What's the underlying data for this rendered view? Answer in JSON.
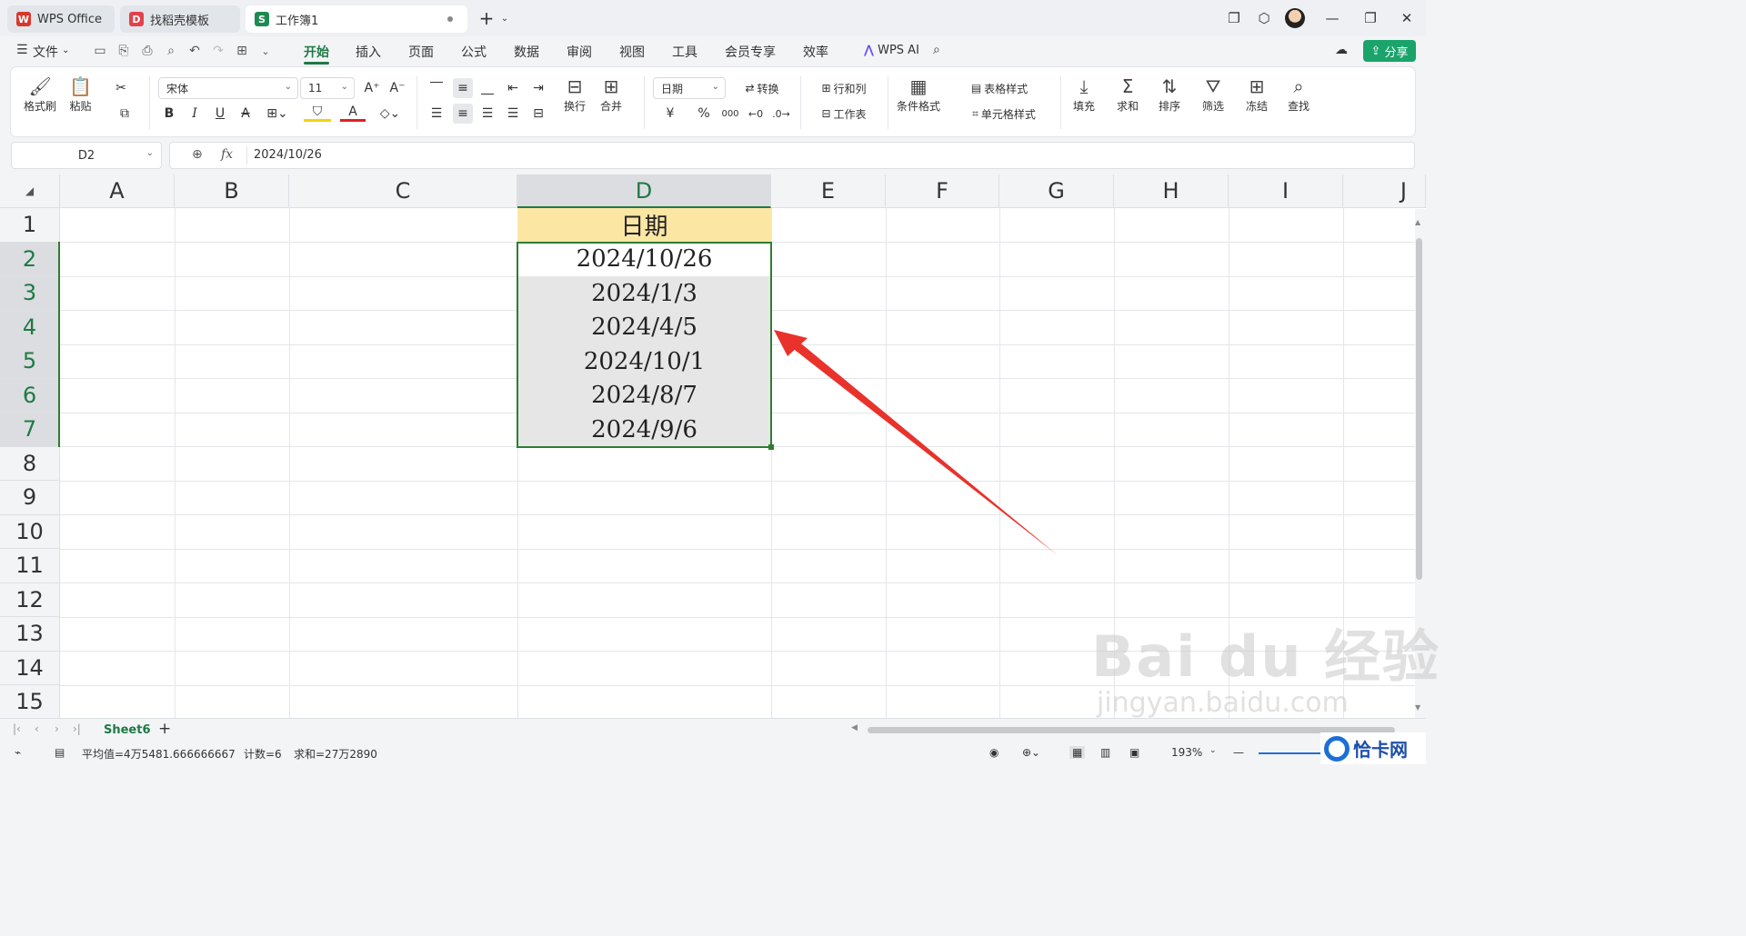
{
  "tabs": [
    {
      "label": "WPS Office",
      "badge": "W",
      "color": "#d8372c"
    },
    {
      "label": "找稻壳模板",
      "badge": "D",
      "color": "#e2424b"
    },
    {
      "label": "工作簿1",
      "badge": "S",
      "color": "#1e8a52"
    }
  ],
  "new_tab": "+",
  "menu": {
    "file": "文件",
    "items": [
      "开始",
      "插入",
      "页面",
      "公式",
      "数据",
      "审阅",
      "视图",
      "工具",
      "会员专享",
      "效率"
    ],
    "wps_ai": "WPS AI",
    "share": "分享"
  },
  "ribbon": {
    "format_painter": "格式刷",
    "paste": "粘贴",
    "font_name": "宋体",
    "font_size": "11",
    "bold": "B",
    "italic": "I",
    "underline": "U",
    "strike": "A",
    "wrap": "换行",
    "merge": "合并",
    "number_format": "日期",
    "convert": "转换",
    "rows_cols": "行和列",
    "worksheet": "工作表",
    "cond_format": "条件格式",
    "table_style": "表格样式",
    "cell_style": "单元格样式",
    "fill": "填充",
    "sum": "求和",
    "sort": "排序",
    "filter": "筛选",
    "freeze": "冻结",
    "find": "查找",
    "currency": "¥",
    "percent": "%",
    "thousands": "000"
  },
  "formula": {
    "cell_ref": "D2",
    "fx": "fx",
    "value": "2024/10/26"
  },
  "columns": [
    "A",
    "B",
    "C",
    "D",
    "E",
    "F",
    "G",
    "H",
    "I",
    "J"
  ],
  "rows": [
    "1",
    "2",
    "3",
    "4",
    "5",
    "6",
    "7",
    "8",
    "9",
    "10",
    "11",
    "12",
    "13",
    "14",
    "15"
  ],
  "cells": {
    "header": "日期",
    "values": [
      "2024/10/26",
      "2024/1/3",
      "2024/4/5",
      "2024/10/1",
      "2024/8/7",
      "2024/9/6"
    ]
  },
  "sheet": {
    "name": "Sheet6",
    "add": "+"
  },
  "status": {
    "average": "平均值=4万5481.666666667",
    "count": "计数=6",
    "sum": "求和=27万2890",
    "zoom": "193%"
  },
  "watermark": {
    "big": "Bai du 经验",
    "small": "jingyan.baidu.com"
  },
  "corner_logo": "恰卡网",
  "colors": {
    "accent": "#1e7a45",
    "header_fill": "#fce6a4",
    "arrow": "#e8322b",
    "share": "#1aa46b"
  }
}
